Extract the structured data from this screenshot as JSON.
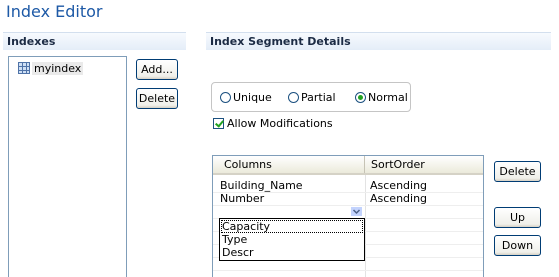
{
  "title": "Index Editor",
  "indexes": {
    "header": "Indexes",
    "items": [
      {
        "label": "myindex",
        "icon": "table-icon"
      }
    ],
    "add_label": "Add...",
    "delete_label": "Delete"
  },
  "segment": {
    "header": "Index Segment Details",
    "radios": [
      {
        "label": "Unique",
        "checked": false
      },
      {
        "label": "Partial",
        "checked": false
      },
      {
        "label": "Normal",
        "checked": true
      }
    ],
    "allow_modifications": {
      "label": "Allow Modifications",
      "checked": true
    },
    "table": {
      "headers": [
        "Columns",
        "SortOrder"
      ],
      "rows": [
        {
          "column": "Building_Name",
          "sort": "Ascending"
        },
        {
          "column": "Number",
          "sort": "Ascending"
        }
      ]
    },
    "dropdown_options": [
      "Capacity",
      "Type",
      "Descr"
    ],
    "delete_label": "Delete",
    "up_label": "Up",
    "down_label": "Down"
  },
  "colors": {
    "title": "#1d59a6",
    "radio_selected": "#21a121"
  }
}
